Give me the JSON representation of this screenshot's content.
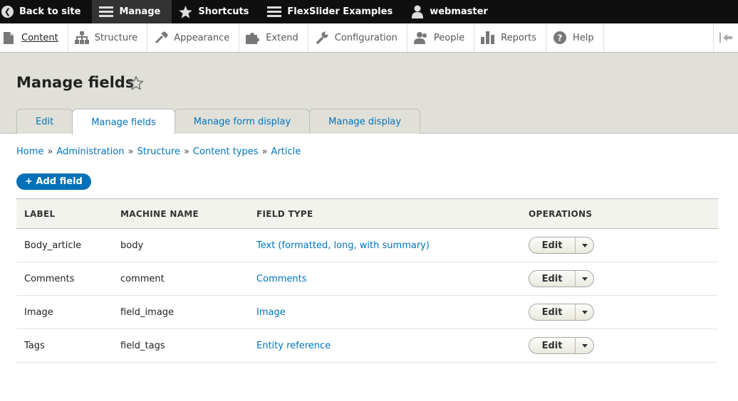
{
  "toolbar": {
    "back_label": "Back to site",
    "manage_label": "Manage",
    "shortcuts_label": "Shortcuts",
    "flexslider_label": "FlexSlider Examples",
    "user_label": "webmaster"
  },
  "tray": {
    "items": [
      {
        "label": "Content",
        "icon": "content-icon"
      },
      {
        "label": "Structure",
        "icon": "structure-icon"
      },
      {
        "label": "Appearance",
        "icon": "appearance-icon"
      },
      {
        "label": "Extend",
        "icon": "extend-icon"
      },
      {
        "label": "Configuration",
        "icon": "configuration-icon"
      },
      {
        "label": "People",
        "icon": "people-icon"
      },
      {
        "label": "Reports",
        "icon": "reports-icon"
      },
      {
        "label": "Help",
        "icon": "help-icon"
      }
    ]
  },
  "page": {
    "title": "Manage fields",
    "tabs": [
      "Edit",
      "Manage fields",
      "Manage form display",
      "Manage display"
    ],
    "active_tab": "Manage fields"
  },
  "breadcrumb": [
    "Home",
    "Administration",
    "Structure",
    "Content types",
    "Article"
  ],
  "breadcrumb_sep": "»",
  "add_field_label": "+ Add field",
  "table": {
    "headers": [
      "LABEL",
      "MACHINE NAME",
      "FIELD TYPE",
      "OPERATIONS"
    ],
    "rows": [
      {
        "label": "Body_article",
        "machine": "body",
        "type": "Text (formatted, long, with summary)",
        "op": "Edit"
      },
      {
        "label": "Comments",
        "machine": "comment",
        "type": "Comments",
        "op": "Edit"
      },
      {
        "label": "Image",
        "machine": "field_image",
        "type": "Image",
        "op": "Edit"
      },
      {
        "label": "Tags",
        "machine": "field_tags",
        "type": "Entity reference",
        "op": "Edit"
      }
    ]
  },
  "colors": {
    "link": "#0074bd",
    "primary_button": "#0071b8",
    "toolbar_bg": "#0f0f0f"
  }
}
